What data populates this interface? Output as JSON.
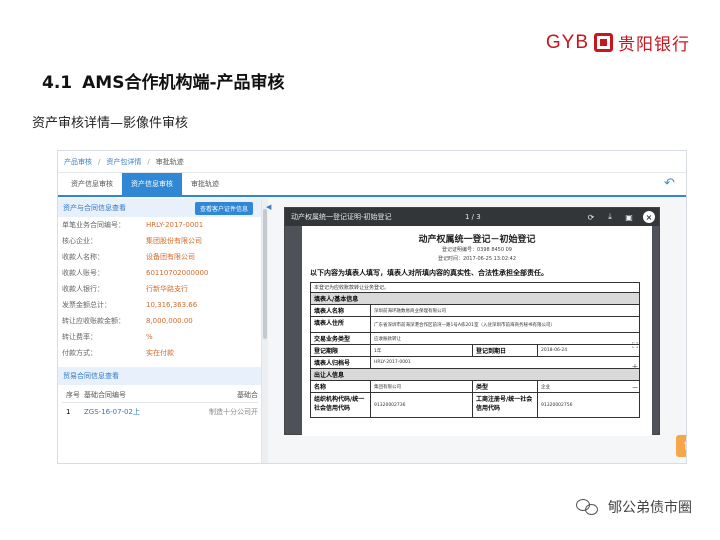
{
  "logo": {
    "brand_en": "GYB",
    "brand_cn": "贵阳银行"
  },
  "heading": {
    "number": "4.1",
    "title": "AMS合作机构端-产品审核"
  },
  "subheading": "资产审核详情—影像件审核",
  "screenshot": {
    "breadcrumbs": [
      "产品审核",
      "资产包详情",
      "审批轨迹"
    ],
    "tabs": [
      {
        "label": "资产信息审核",
        "active": false
      },
      {
        "label": "资产信息审核",
        "active": true
      },
      {
        "label": "审批轨迹",
        "active": false
      }
    ],
    "left_panel": {
      "section1_title": "资产与合同信息查看",
      "section1_button": "查看客户证件信息",
      "fields": [
        {
          "label": "单笔业务合同编号：",
          "value": "HRLY-2017-0001"
        },
        {
          "label": "核心企业：",
          "value": "集团股份有限公司"
        },
        {
          "label": "收款人名称：",
          "value": "设备团有限公司"
        },
        {
          "label": "收款人账号：",
          "value": "60110702000000"
        },
        {
          "label": "收款人银行：",
          "value": "行新华路支行"
        },
        {
          "label": "发票金额总计：",
          "value": "10,316,363.66"
        },
        {
          "label": "转让应收账款金额：",
          "value": "8,000,000.00"
        },
        {
          "label": "转让费率：",
          "value": "%"
        },
        {
          "label": "付款方式：",
          "value": "实在付款"
        }
      ],
      "section2_title": "贸易合同信息查看",
      "table_headers": [
        "序号",
        "基础合同编号",
        "基础合"
      ],
      "table_rows": [
        {
          "index": "1",
          "contract_no": "ZGS-16-07-02上",
          "name": "制造十分公司开"
        }
      ]
    },
    "viewer": {
      "doc_name": "动产权属统一登记证明-初始登记",
      "page_indicator": "1 / 3",
      "paper": {
        "title": "动产权属统一登记－初始登记",
        "reg_no": "登记证明编号：0398 8450 09",
        "reg_time": "登记时间：2017-06-25 13:02:42",
        "notice": "以下内容为填表人填写，填表人对所填内容的真实性、合法性承担全部责任。",
        "statement": "本登记为应收账款转让业务登记。",
        "section_filer": "填表人/基本信息",
        "filer_name_label": "填表人名称",
        "filer_name_value": "深圳前海环融数易商业保理有限公司",
        "filer_addr_label": "填表人住所",
        "filer_addr_value": "广东省深圳市前海深港合作区前湾一路1号A栋201室（入驻深圳市前海商务秘书有限公司）",
        "type_label": "交易业务类型",
        "type_value": "应收账款转让",
        "term_label": "登记期限",
        "term_value": "1年",
        "expire_label": "登记到期日",
        "expire_value": "2018-06-24",
        "file_no_label": "填表人归档号",
        "file_no_value": "HRLY-2017-0001",
        "section_transferor": "出让人信息",
        "name_label": "名称",
        "name_value": "集团有限公司",
        "kind_label": "类型",
        "kind_value": "企业",
        "org_code_label": "组织机构代码/统一社会信用代码",
        "org_code_value": "91320002736",
        "biz_code_label": "工商注册号/统一社会信用代码",
        "biz_code_value": "91320002756"
      }
    }
  },
  "watermark": "郇公弟债市圈",
  "colors": {
    "brand_red": "#c8161d",
    "accent_blue": "#2f87d6",
    "value_orange": "#d46a2a",
    "up_button": "#f7a64b"
  }
}
